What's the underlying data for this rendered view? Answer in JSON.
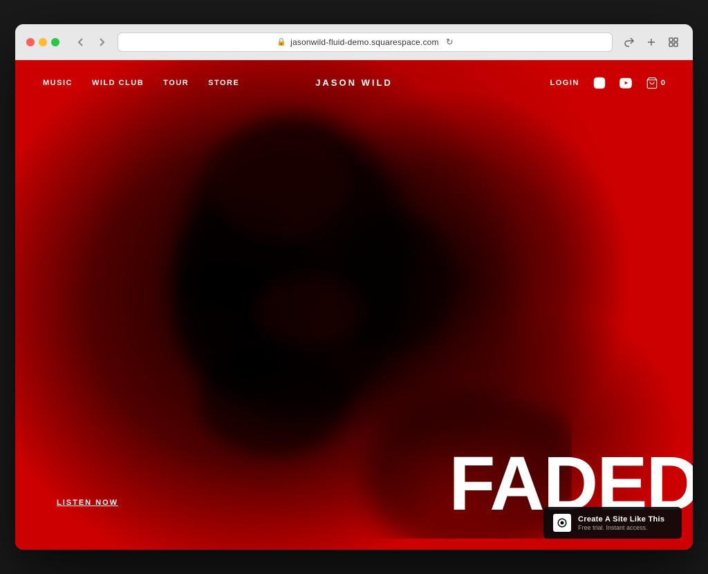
{
  "browser": {
    "url": "jasonwild-fluid-demo.squarespace.com",
    "back_btn": "‹",
    "forward_btn": "›"
  },
  "nav": {
    "items": [
      {
        "label": "MUSIC",
        "id": "music"
      },
      {
        "label": "WILD CLUB",
        "id": "wild-club"
      },
      {
        "label": "TOUR",
        "id": "tour"
      },
      {
        "label": "STORE",
        "id": "store"
      }
    ],
    "site_title": "JASON WILD",
    "login_label": "LOGIN",
    "cart_count": "0"
  },
  "hero": {
    "title": "FADED",
    "cta_label": "LISTEN NOW"
  },
  "badge": {
    "main_text": "Create A Site Like This",
    "sub_text": "Free trial. Instant access."
  }
}
